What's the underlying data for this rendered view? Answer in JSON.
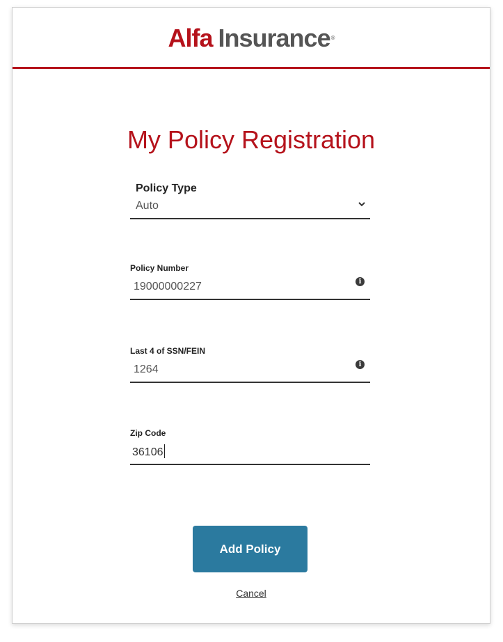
{
  "header": {
    "logo_brand": "Alfa",
    "logo_word": "Insurance",
    "logo_mark": "®"
  },
  "page": {
    "title": "My Policy Registration"
  },
  "form": {
    "policy_type": {
      "label": "Policy Type",
      "selected": "Auto",
      "icon": "chevron-down-icon"
    },
    "policy_number": {
      "label": "Policy Number",
      "value": "19000000227",
      "icon": "info-icon"
    },
    "ssn": {
      "label": "Last 4 of SSN/FEIN",
      "value": "1264",
      "icon": "info-icon"
    },
    "zip": {
      "label": "Zip Code",
      "value": "36106"
    }
  },
  "actions": {
    "add_policy_label": "Add Policy",
    "cancel_label": "Cancel"
  },
  "colors": {
    "brand_red": "#b5121b",
    "button_blue": "#2b7a9f",
    "text_dark": "#222222"
  }
}
